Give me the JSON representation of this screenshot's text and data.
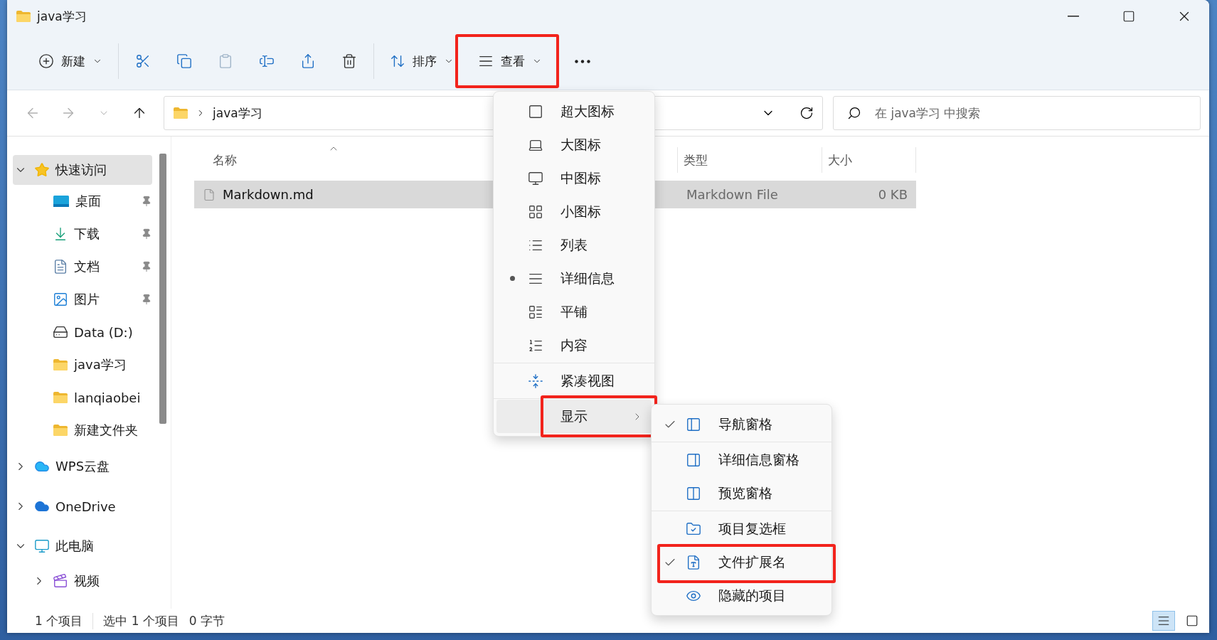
{
  "window": {
    "title": "java学习"
  },
  "toolbar": {
    "groups": [
      {
        "items": [
          {
            "kind": "new",
            "label": "新建",
            "dropdown": true,
            "disabled": false,
            "highlighted": false
          }
        ]
      },
      {
        "items": [
          {
            "kind": "cut",
            "dropdown": false,
            "disabled": false,
            "highlighted": false
          },
          {
            "kind": "copy",
            "dropdown": false,
            "disabled": false,
            "highlighted": false
          },
          {
            "kind": "paste",
            "dropdown": false,
            "disabled": true,
            "highlighted": false
          },
          {
            "kind": "rename",
            "dropdown": false,
            "disabled": false,
            "highlighted": false
          },
          {
            "kind": "share",
            "dropdown": false,
            "disabled": false,
            "highlighted": false
          },
          {
            "kind": "delete",
            "dropdown": false,
            "disabled": false,
            "highlighted": false
          }
        ]
      },
      {
        "items": [
          {
            "kind": "sort",
            "label": "排序",
            "dropdown": true,
            "disabled": false,
            "highlighted": false
          },
          {
            "kind": "view",
            "label": "查看",
            "dropdown": true,
            "disabled": false,
            "highlighted": true
          }
        ]
      },
      {
        "items": [
          {
            "kind": "more",
            "dropdown": false,
            "disabled": false,
            "highlighted": false
          }
        ]
      }
    ]
  },
  "nav": [
    {
      "kind": "back",
      "disabled": true
    },
    {
      "kind": "forward",
      "disabled": true
    },
    {
      "kind": "recent",
      "disabled": true
    },
    {
      "kind": "up",
      "disabled": false
    }
  ],
  "address": {
    "path": [
      "java学习"
    ]
  },
  "search": {
    "placeholder": "在 java学习 中搜索"
  },
  "sidebar": {
    "items": [
      {
        "kind": "star",
        "label": "快速访问",
        "expanded": true,
        "selected": true,
        "children": [
          {
            "kind": "desktop",
            "label": "桌面",
            "pinned": true,
            "selected": false
          },
          {
            "kind": "download",
            "label": "下载",
            "pinned": true,
            "selected": false
          },
          {
            "kind": "documents",
            "label": "文档",
            "pinned": true,
            "selected": false
          },
          {
            "kind": "pictures",
            "label": "图片",
            "pinned": true,
            "selected": false
          },
          {
            "kind": "drive",
            "label": "Data (D:)",
            "pinned": false,
            "selected": false
          },
          {
            "kind": "folder",
            "label": "java学习",
            "pinned": false,
            "selected": false
          },
          {
            "kind": "folder",
            "label": "lanqiaobei",
            "pinned": false,
            "selected": false
          },
          {
            "kind": "folder",
            "label": "新建文件夹",
            "pinned": false,
            "selected": false
          }
        ]
      },
      {
        "kind": "wps",
        "label": "WPS云盘",
        "expanded": false,
        "selected": false
      },
      {
        "kind": "onedrive",
        "label": "OneDrive",
        "expanded": false,
        "selected": false
      },
      {
        "kind": "pc",
        "label": "此电脑",
        "expanded": true,
        "selected": false,
        "children": [
          {
            "kind": "videos",
            "label": "视频",
            "expanded": false,
            "selected": false
          }
        ]
      }
    ]
  },
  "table": {
    "columns": [
      {
        "label": "名称",
        "sorted": true
      },
      {
        "label": "类型",
        "sorted": false
      },
      {
        "label": "大小",
        "sorted": false
      }
    ],
    "rows": [
      {
        "name": "Markdown.md",
        "type": "Markdown File",
        "size": "0 KB",
        "selected": true
      }
    ]
  },
  "view_menu": {
    "sections": [
      [
        {
          "kind": "extra-large",
          "label": "超大图标",
          "selected": false
        },
        {
          "kind": "large",
          "label": "大图标",
          "selected": false
        },
        {
          "kind": "medium",
          "label": "中图标",
          "selected": false
        },
        {
          "kind": "small",
          "label": "小图标",
          "selected": false
        },
        {
          "kind": "list",
          "label": "列表",
          "selected": false
        },
        {
          "kind": "details",
          "label": "详细信息",
          "selected": true
        },
        {
          "kind": "tiles",
          "label": "平铺",
          "selected": false
        },
        {
          "kind": "content",
          "label": "内容",
          "selected": false
        }
      ],
      [
        {
          "kind": "compact",
          "label": "紧凑视图",
          "selected": false
        }
      ],
      [
        {
          "kind": "submenu",
          "label": "显示",
          "selected": false,
          "active": true,
          "highlighted": true
        }
      ]
    ]
  },
  "show_menu": {
    "sections": [
      [
        {
          "kind": "nav-pane",
          "label": "导航窗格",
          "checked": true,
          "highlighted": false
        }
      ],
      [
        {
          "kind": "details-pane",
          "label": "详细信息窗格",
          "checked": false,
          "highlighted": false
        },
        {
          "kind": "preview-pane",
          "label": "预览窗格",
          "checked": false,
          "highlighted": false
        }
      ],
      [
        {
          "kind": "checkboxes",
          "label": "项目复选框",
          "checked": false,
          "highlighted": false
        },
        {
          "kind": "extensions",
          "label": "文件扩展名",
          "checked": true,
          "highlighted": true
        },
        {
          "kind": "hidden",
          "label": "隐藏的项目",
          "checked": false,
          "highlighted": false
        }
      ]
    ]
  },
  "status_bar": {
    "count": "1 个项目",
    "selection": "选中 1 个项目",
    "size": "0 字节",
    "views": [
      {
        "kind": "details",
        "selected": true
      },
      {
        "kind": "tiles",
        "selected": false
      }
    ]
  }
}
